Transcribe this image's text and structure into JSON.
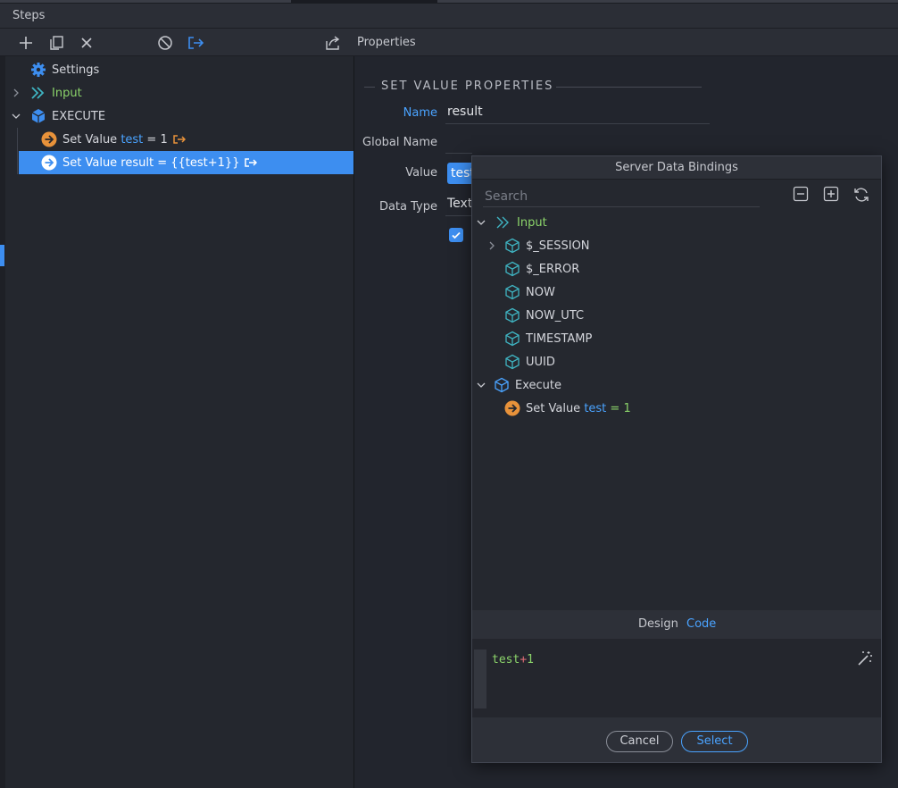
{
  "steps_panel": {
    "title": "Steps"
  },
  "properties_panel": {
    "title": "Properties"
  },
  "tree": {
    "settings": "Settings",
    "input": "Input",
    "execute": "EXECUTE",
    "step1": {
      "prefix": "Set Value ",
      "var": "test",
      "suffix": " = 1"
    },
    "step2": {
      "label": "Set Value result = {{test+1}}"
    }
  },
  "properties": {
    "section_title": "SET VALUE PROPERTIES",
    "name_label": "Name",
    "name_value": "result",
    "global_name_label": "Global Name",
    "global_name_value": "",
    "value_label": "Value",
    "value_value": "test",
    "data_type_label": "Data Type",
    "data_type_value": "Text"
  },
  "bindings_modal": {
    "title": "Server Data Bindings",
    "search_placeholder": "Search",
    "tree": {
      "input": "Input",
      "session": "$_SESSION",
      "error": "$_ERROR",
      "now": "NOW",
      "now_utc": "NOW_UTC",
      "timestamp": "TIMESTAMP",
      "uuid": "UUID",
      "execute": "Execute",
      "set_value_prefix": "Set Value ",
      "set_value_var": "test",
      "set_value_suffix": " = 1"
    },
    "tabs": {
      "design": "Design",
      "code": "Code"
    },
    "code": {
      "var": "test",
      "op": "+",
      "num": "1"
    },
    "buttons": {
      "cancel": "Cancel",
      "select": "Select"
    }
  },
  "colors": {
    "accent": "#3d8ef0",
    "green": "#8bd36a",
    "orange": "#e8923a",
    "teal": "#3fb4c2"
  }
}
